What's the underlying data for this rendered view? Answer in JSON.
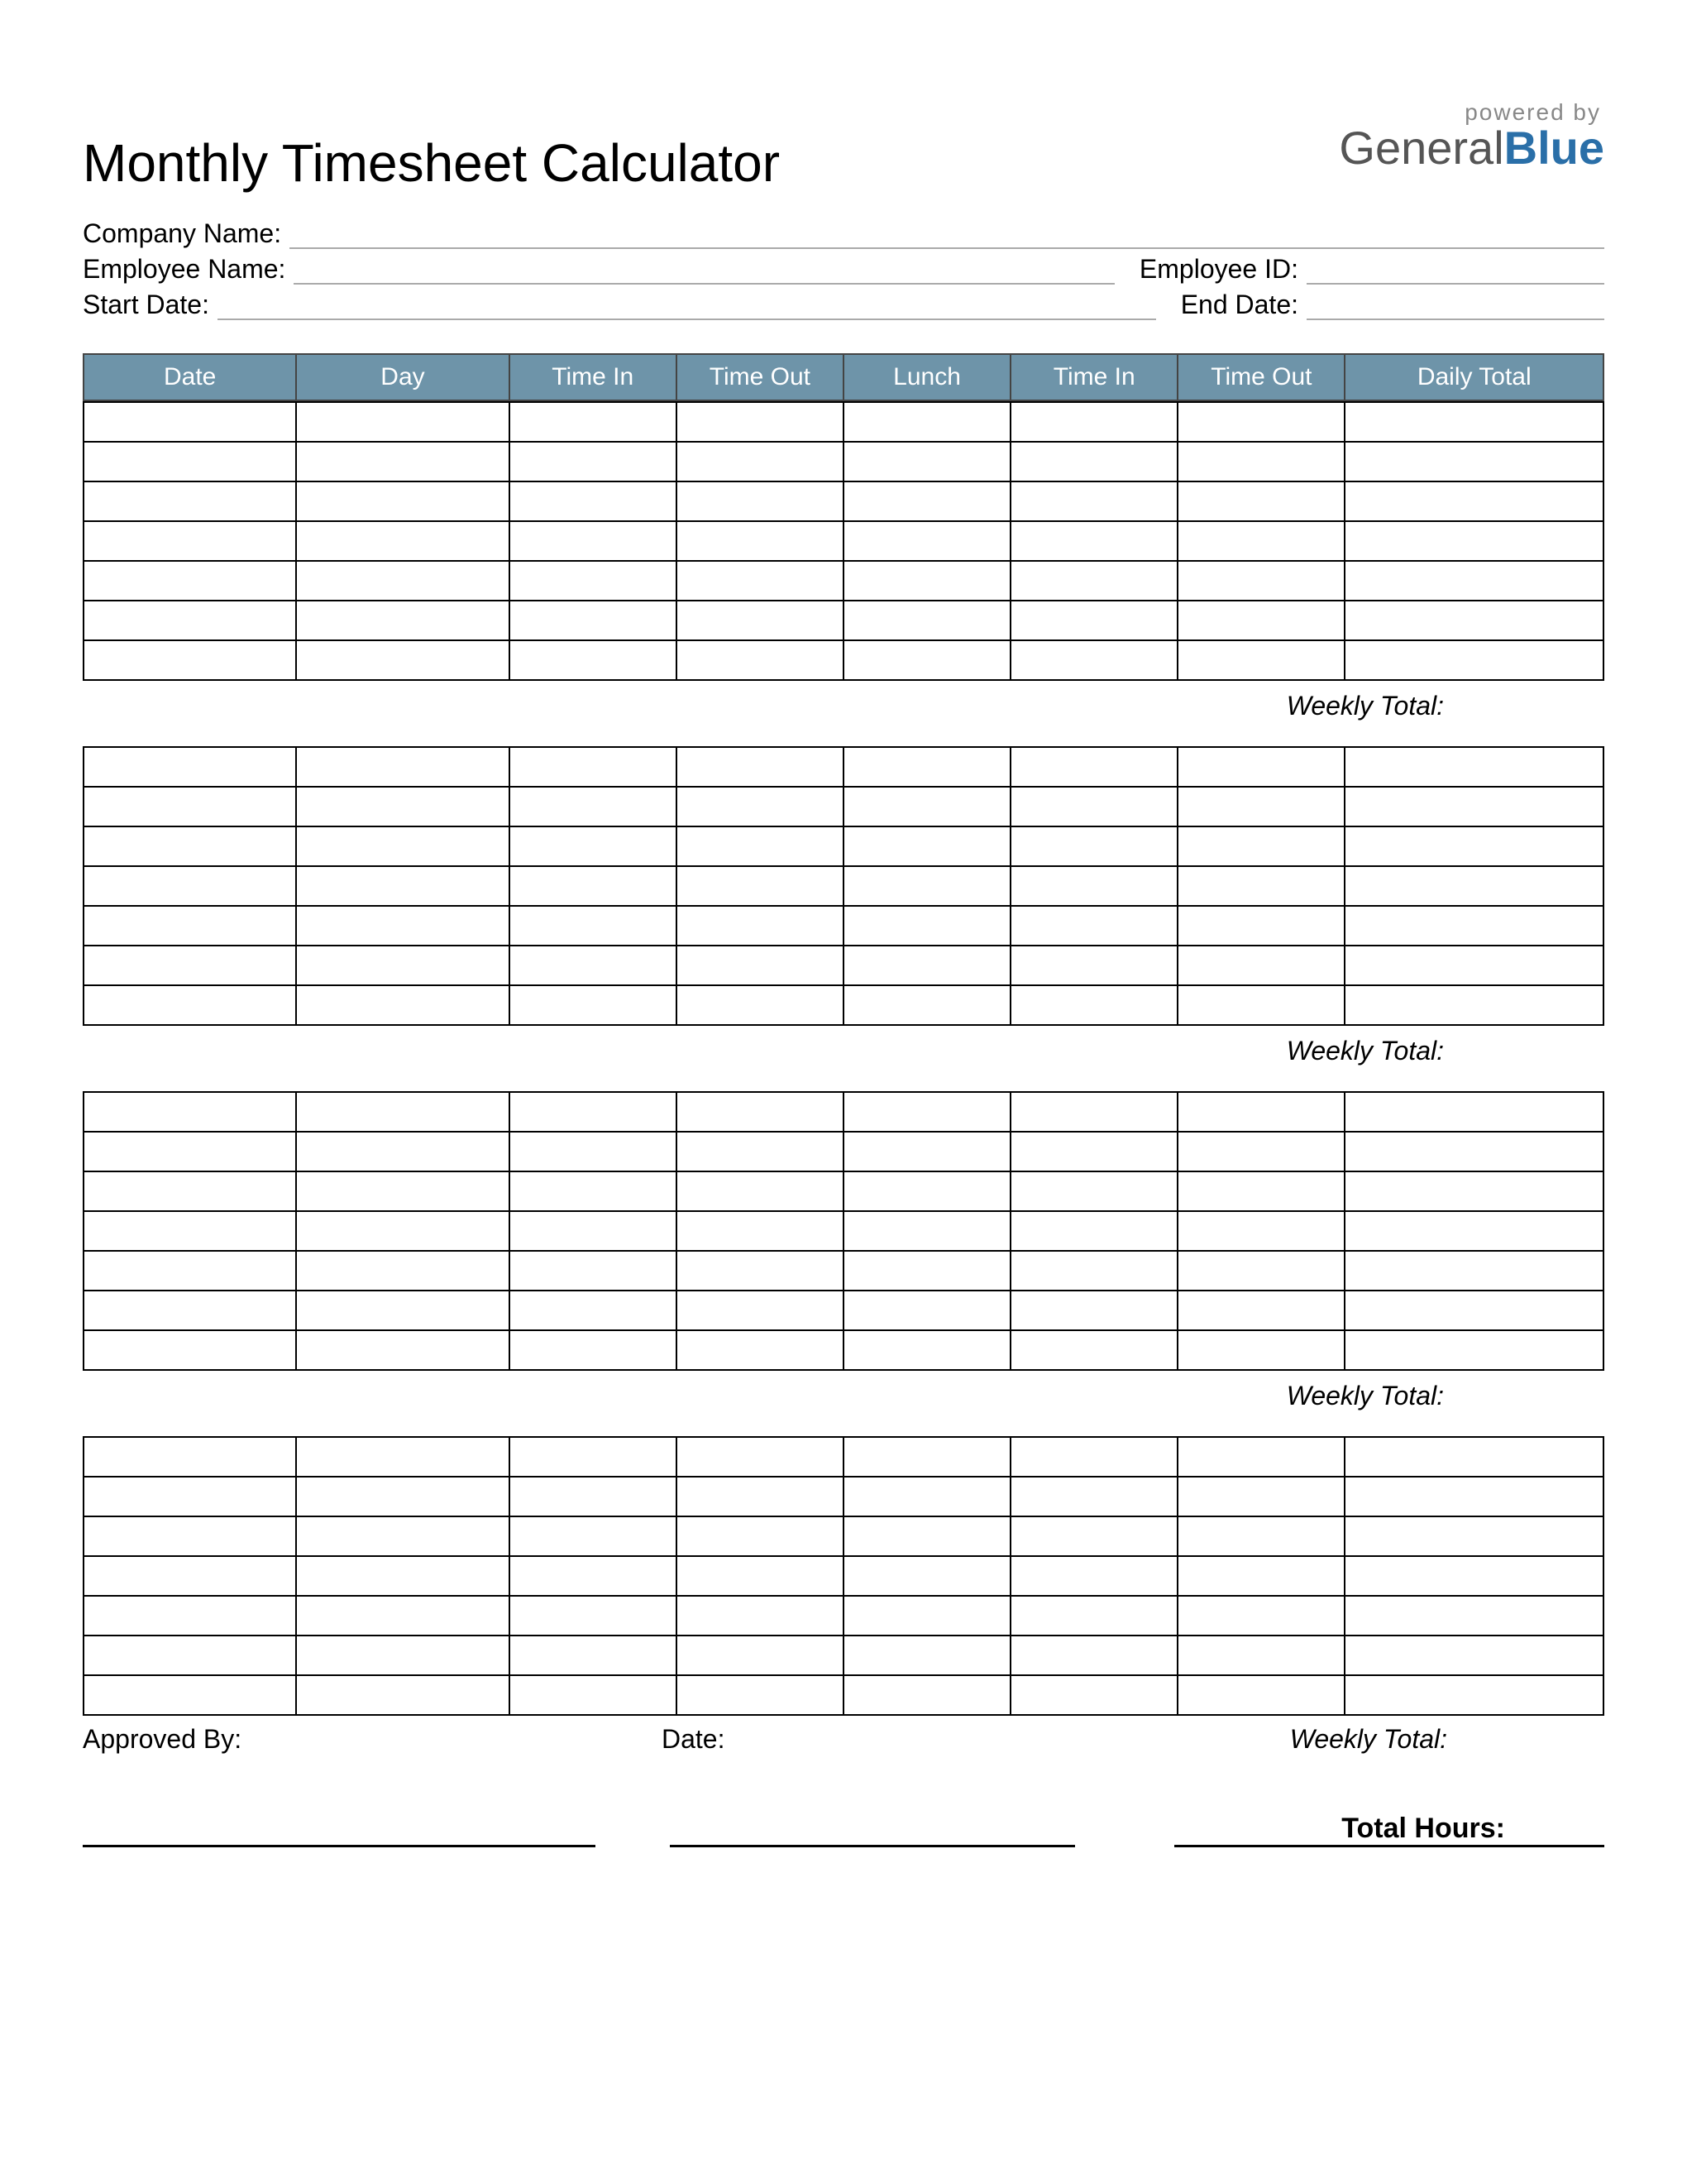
{
  "header": {
    "title": "Monthly Timesheet Calculator",
    "powered_by": "powered by",
    "brand_part1": "General",
    "brand_part2": "Blue"
  },
  "info": {
    "company_label": "Company Name:",
    "employee_label": "Employee Name:",
    "employee_id_label": "Employee ID:",
    "start_date_label": "Start Date:",
    "end_date_label": "End Date:"
  },
  "columns": {
    "date": "Date",
    "day": "Day",
    "time_in": "Time In",
    "time_out": "Time Out",
    "lunch": "Lunch",
    "time_in2": "Time In",
    "time_out2": "Time Out",
    "daily_total": "Daily Total"
  },
  "weeks": [
    {
      "rows": 7,
      "weekly_total_label": "Weekly Total:"
    },
    {
      "rows": 7,
      "weekly_total_label": "Weekly Total:"
    },
    {
      "rows": 7,
      "weekly_total_label": "Weekly Total:"
    },
    {
      "rows": 7,
      "weekly_total_label": "Weekly Total:"
    }
  ],
  "footer": {
    "approved_by_label": "Approved By:",
    "date_label": "Date:",
    "total_hours_label": "Total Hours:"
  }
}
